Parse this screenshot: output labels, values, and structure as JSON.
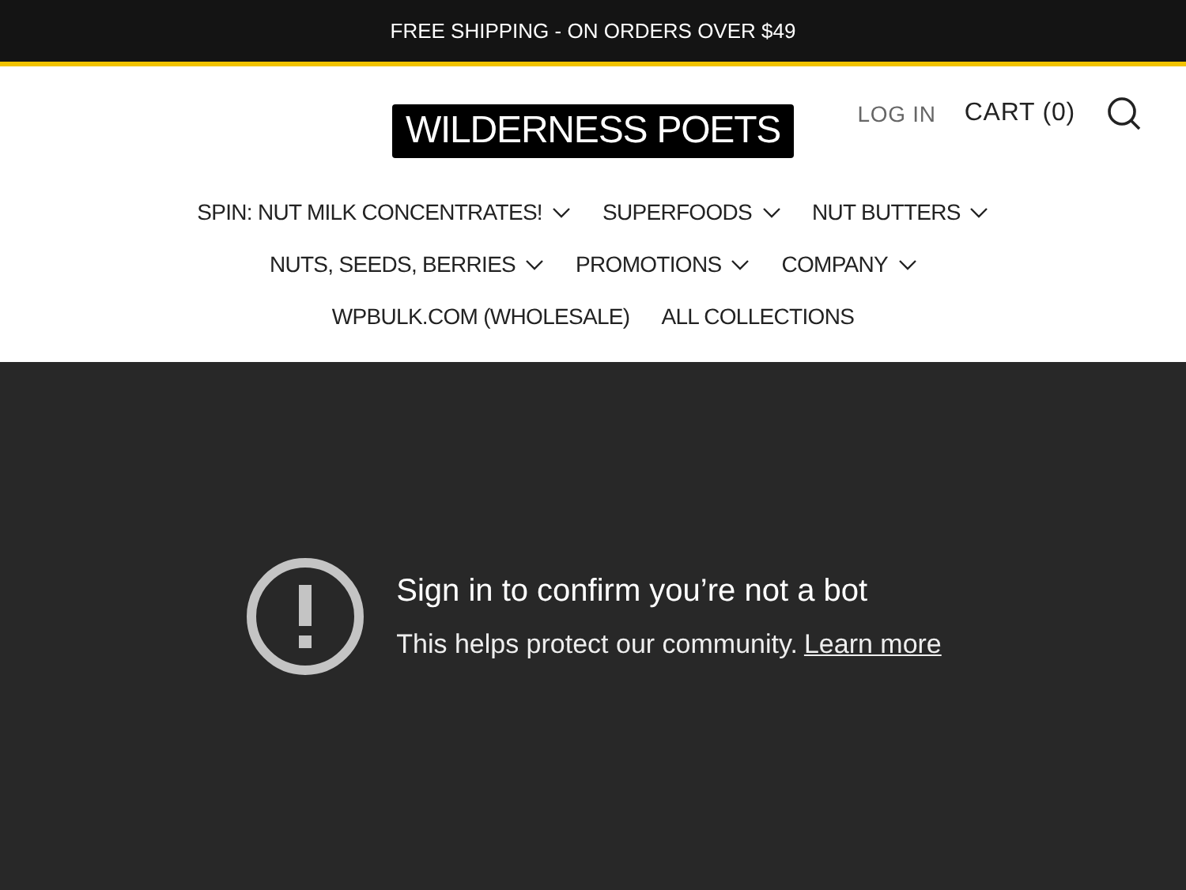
{
  "announcement": "FREE SHIPPING - ON ORDERS OVER $49",
  "header": {
    "logo": "WILDERNESS POETS",
    "login": "LOG IN",
    "cart": "CART (0)"
  },
  "nav": {
    "rows": [
      [
        {
          "label": "SPIN: NUT MILK CONCENTRATES!",
          "dropdown": true
        },
        {
          "label": "SUPERFOODS",
          "dropdown": true
        },
        {
          "label": "NUT BUTTERS",
          "dropdown": true
        }
      ],
      [
        {
          "label": "NUTS, SEEDS, BERRIES",
          "dropdown": true
        },
        {
          "label": "PROMOTIONS",
          "dropdown": true
        },
        {
          "label": "COMPANY",
          "dropdown": true
        }
      ],
      [
        {
          "label": "WPBULK.COM (WHOLESALE)",
          "dropdown": false
        },
        {
          "label": "ALL COLLECTIONS",
          "dropdown": false
        }
      ]
    ]
  },
  "embed": {
    "title": "Sign in to confirm you’re not a bot",
    "message": "This helps protect our community.",
    "link": "Learn more"
  }
}
